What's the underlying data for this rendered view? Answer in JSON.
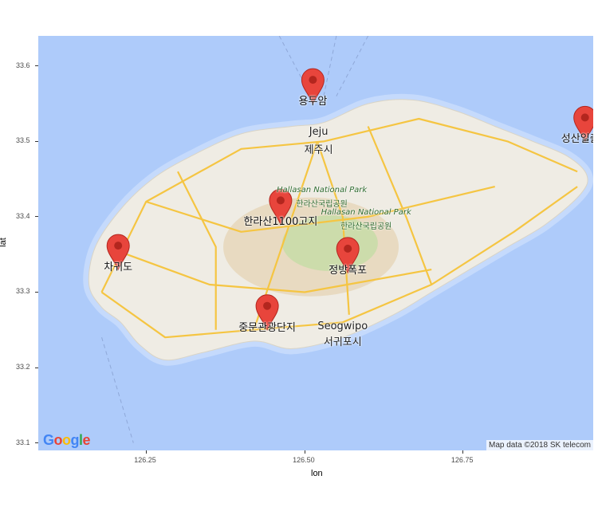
{
  "axes": {
    "xlabel": "lon",
    "ylabel": "lat",
    "xticks": [
      126.25,
      126.5,
      126.75
    ],
    "xtick_labels": [
      "126.25",
      "126.50",
      "126.75"
    ],
    "yticks": [
      33.1,
      33.2,
      33.3,
      33.4,
      33.5,
      33.6
    ],
    "ytick_labels": [
      "33.1",
      "33.2",
      "33.3",
      "33.4",
      "33.5",
      "33.6"
    ],
    "xlim": [
      126.08,
      126.955
    ],
    "ylim": [
      33.09,
      33.64
    ]
  },
  "markers": [
    {
      "name": "용두암",
      "lon": 126.513,
      "lat": 33.55
    },
    {
      "name": "성산일출봉",
      "lon": 126.942,
      "lat": 33.5
    },
    {
      "name": "한라산1100고지",
      "lon": 126.462,
      "lat": 33.39
    },
    {
      "name": "차귀도",
      "lon": 126.206,
      "lat": 33.33
    },
    {
      "name": "정방폭포",
      "lon": 126.568,
      "lat": 33.326
    },
    {
      "name": "중문관광단지",
      "lon": 126.441,
      "lat": 33.25
    }
  ],
  "map_labels": [
    {
      "text": "Jeju",
      "lon": 126.522,
      "lat": 33.512,
      "style": "city"
    },
    {
      "text": "제주시",
      "lon": 126.522,
      "lat": 33.492,
      "style": "city"
    },
    {
      "text": "Hallasan National Park",
      "lon": 126.527,
      "lat": 33.433,
      "style": "park"
    },
    {
      "text": "한라산국립공원",
      "lon": 126.527,
      "lat": 33.418,
      "style": "park-ko"
    },
    {
      "text": "Hallasan National Park",
      "lon": 126.597,
      "lat": 33.403,
      "style": "park"
    },
    {
      "text": "한라산국립공원",
      "lon": 126.597,
      "lat": 33.388,
      "style": "park-ko"
    },
    {
      "text": "Seogwipo",
      "lon": 126.56,
      "lat": 33.254,
      "style": "city"
    },
    {
      "text": "서귀포시",
      "lon": 126.56,
      "lat": 33.237,
      "style": "city"
    }
  ],
  "attribution": "Map data ©2018 SK telecom",
  "logo": {
    "letters": [
      "G",
      "o",
      "o",
      "g",
      "l",
      "e"
    ],
    "colors": [
      "#4285F4",
      "#EA4335",
      "#FBBC05",
      "#4285F4",
      "#34A853",
      "#EA4335"
    ]
  },
  "colors": {
    "sea": "#aecbfa",
    "sea_shallow": "#c5dafc",
    "land": "#efece4",
    "park": "#c9dca8",
    "terrain": "#e6d6b8",
    "road": "#f5c542",
    "marker": "#e8453c",
    "marker_dark": "#b3261e"
  }
}
